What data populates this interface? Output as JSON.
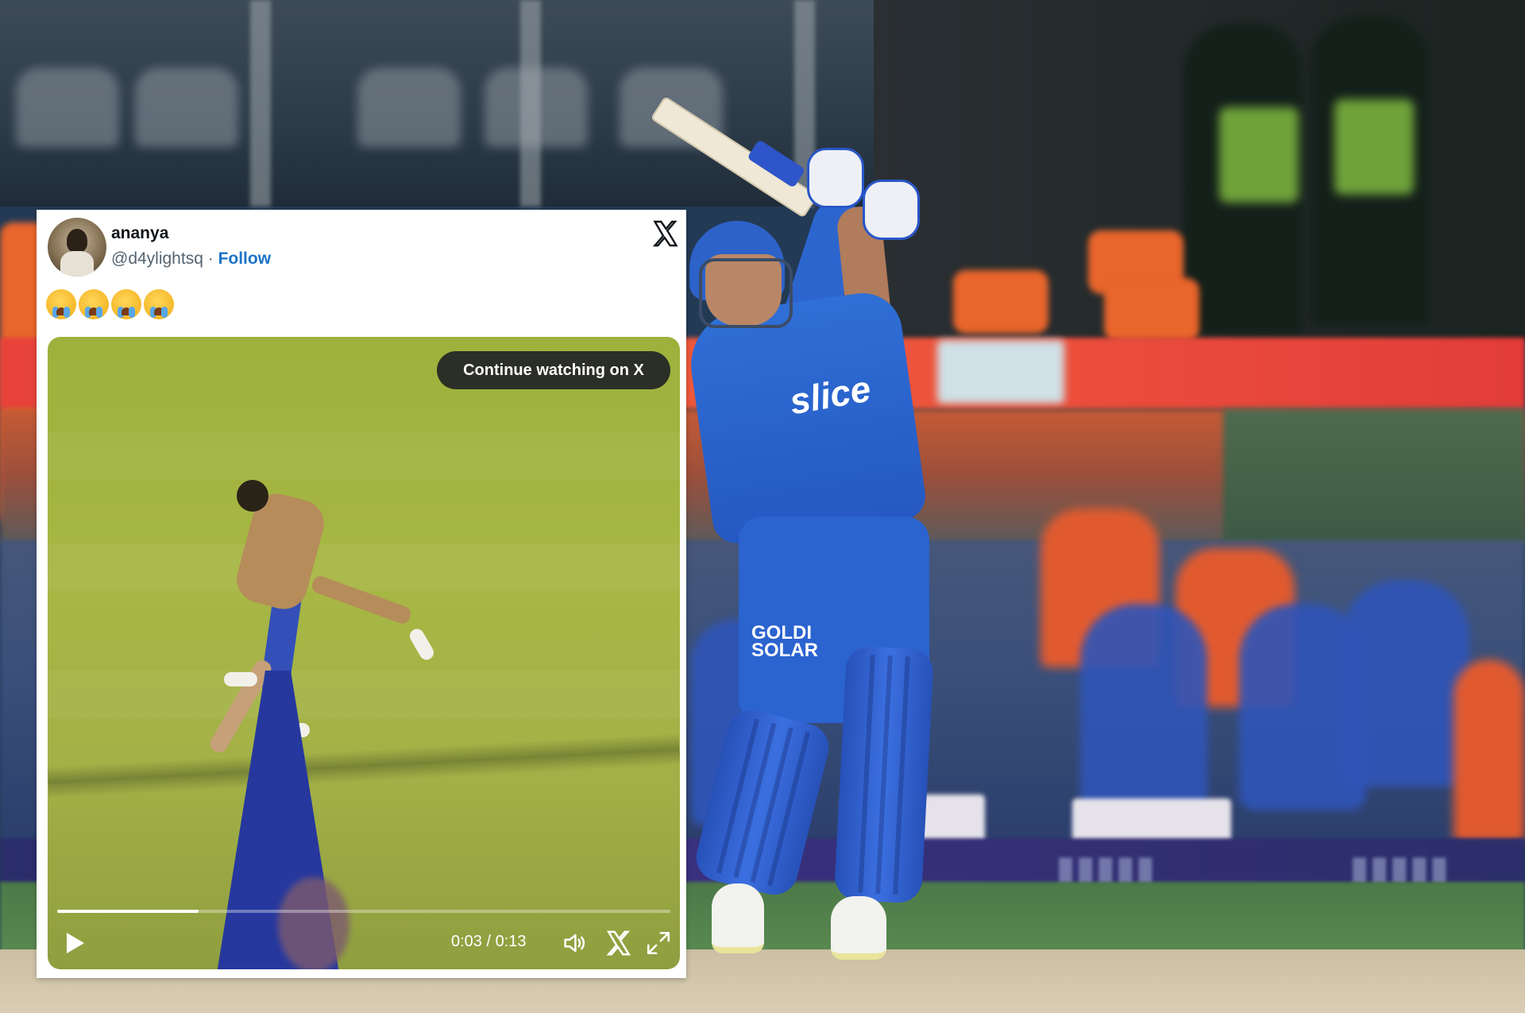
{
  "tweet": {
    "display_name": "ananya",
    "handle": "@d4ylightsq",
    "separator": " · ",
    "follow_label": "Follow",
    "emoji_count": 4,
    "emoji": "loudly-crying-face",
    "platform_icon": "x-logo-icon"
  },
  "video": {
    "cta_label": "Continue watching on X",
    "current_time": "0:03",
    "duration": "0:13",
    "time_display": "0:03 / 0:13",
    "progress_fraction": 0.23,
    "controls": [
      "play-icon",
      "volume-icon",
      "x-logo-icon",
      "fullscreen-icon"
    ]
  },
  "background": {
    "jersey_sponsor": "slice",
    "jersey_sponsor_2": "GOLDI SOLAR",
    "colors": {
      "jersey": "#2d65cf",
      "banner": "#e8423b",
      "accent": "#1d73c7"
    }
  }
}
